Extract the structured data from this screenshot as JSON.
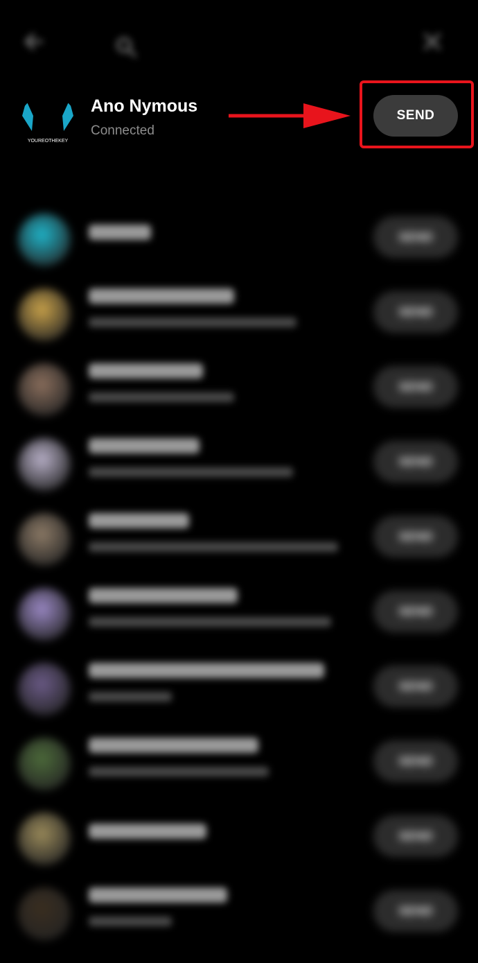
{
  "top_bar": {
    "icons": [
      "back-arrow-icon",
      "search-icon",
      "close-icon"
    ]
  },
  "highlighted_contact": {
    "name": "Ano Nymous",
    "status": "Connected",
    "send_label": "SEND",
    "avatar_text": "YOUREOTHEKEY"
  },
  "list": {
    "section_label": "",
    "rows": [
      {
        "send_label": "SEND",
        "avatar_color": "#1fb4c9"
      },
      {
        "send_label": "SEND",
        "avatar_color": "#c9a24a"
      },
      {
        "send_label": "SEND",
        "avatar_color": "#8a6e5c"
      },
      {
        "send_label": "SEND",
        "avatar_color": "#b8b0c8"
      },
      {
        "send_label": "SEND",
        "avatar_color": "#8c7a66"
      },
      {
        "send_label": "SEND",
        "avatar_color": "#9a88c4"
      },
      {
        "send_label": "SEND",
        "avatar_color": "#6a5a86"
      },
      {
        "send_label": "SEND",
        "avatar_color": "#4c6a3a"
      },
      {
        "send_label": "SEND",
        "avatar_color": "#9a8a5a"
      },
      {
        "send_label": "SEND",
        "avatar_color": "#3a2e20"
      }
    ]
  },
  "colors": {
    "highlight": "#e8141c",
    "background": "#000000",
    "button": "#3b3b3b"
  }
}
